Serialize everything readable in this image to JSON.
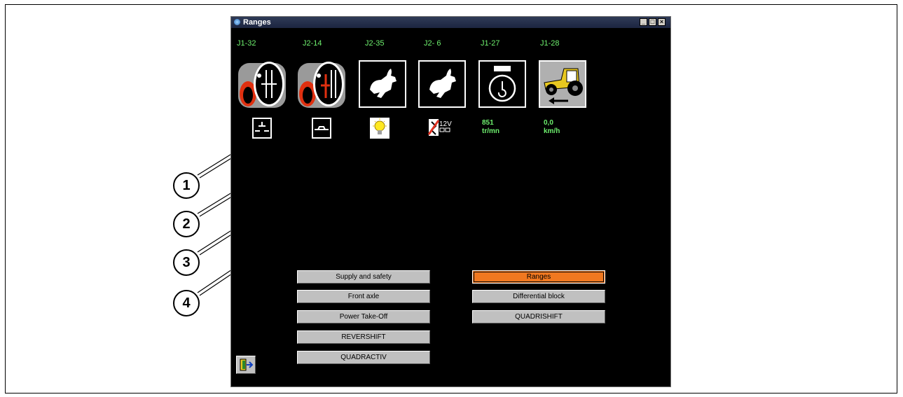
{
  "window": {
    "title": "Ranges",
    "controls": [
      "minimize-icon",
      "maximize-icon",
      "close-icon"
    ]
  },
  "pins": [
    "J1-32",
    "J2-14",
    "J2-35",
    "J2- 6",
    "J1-27",
    "J1-28"
  ],
  "icons": [
    {
      "name": "range-lever-icon-a"
    },
    {
      "name": "range-lever-icon-b"
    },
    {
      "name": "hare-high-speed-icon-a"
    },
    {
      "name": "hare-high-speed-icon-b"
    },
    {
      "name": "engine-speed-gauge-icon"
    },
    {
      "name": "tractor-reverse-speed-icon"
    }
  ],
  "states": {
    "switch_1": "open-switch-icon",
    "switch_2": "closed-switch-icon",
    "lamp": "light-bulb-icon",
    "voltage": {
      "text": "12V",
      "icon": "no-voltage-icon"
    }
  },
  "readouts": {
    "engine_speed": {
      "value": "851",
      "unit": "tr/mn"
    },
    "ground_speed": {
      "value": "0,0",
      "unit": "km/h"
    }
  },
  "menu_left": [
    "Supply and safety",
    "Front axle",
    "Power Take-Off",
    "REVERSHIFT",
    "QUADRACTIV"
  ],
  "menu_right": [
    "Ranges",
    "Differential block",
    "QUADRISHIFT"
  ],
  "active_menu": "Ranges",
  "callouts": [
    "1",
    "2",
    "3",
    "4"
  ],
  "colors": {
    "accent_active": "#f07820",
    "pin_text": "#6ef06e",
    "window_bg": "#000000"
  }
}
